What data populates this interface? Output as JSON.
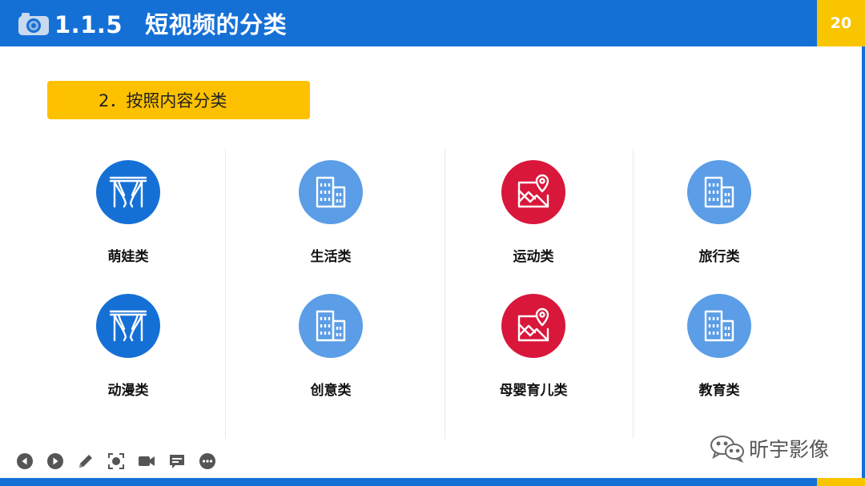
{
  "header": {
    "section_number": "1.1.5",
    "title": "短视频的分类",
    "page_number": "20",
    "icon": "camera-icon",
    "color_primary": "#1570d6",
    "color_accent": "#f9c400"
  },
  "subheading": {
    "label": "2．按照内容分类",
    "color": "#fec100"
  },
  "categories": [
    {
      "label": "萌娃类",
      "icon": "curtain-icon",
      "color": "#1570d6"
    },
    {
      "label": "生活类",
      "icon": "building-icon",
      "color": "#5b9de6"
    },
    {
      "label": "运动类",
      "icon": "map-pin-icon",
      "color": "#d9173b"
    },
    {
      "label": "旅行类",
      "icon": "building-icon",
      "color": "#5b9de6"
    },
    {
      "label": "动漫类",
      "icon": "curtain-icon",
      "color": "#1570d6"
    },
    {
      "label": "创意类",
      "icon": "building-icon",
      "color": "#5b9de6"
    },
    {
      "label": "母婴育儿类",
      "icon": "map-pin-icon",
      "color": "#d9173b"
    },
    {
      "label": "教育类",
      "icon": "building-icon",
      "color": "#5b9de6"
    }
  ],
  "toolbar": [
    "previous-icon",
    "next-icon",
    "pen-icon",
    "zoom-icon",
    "camera-video-icon",
    "subtitle-icon",
    "more-icon"
  ],
  "watermark": {
    "text": "昕宇影像",
    "icon": "wechat-icon"
  }
}
